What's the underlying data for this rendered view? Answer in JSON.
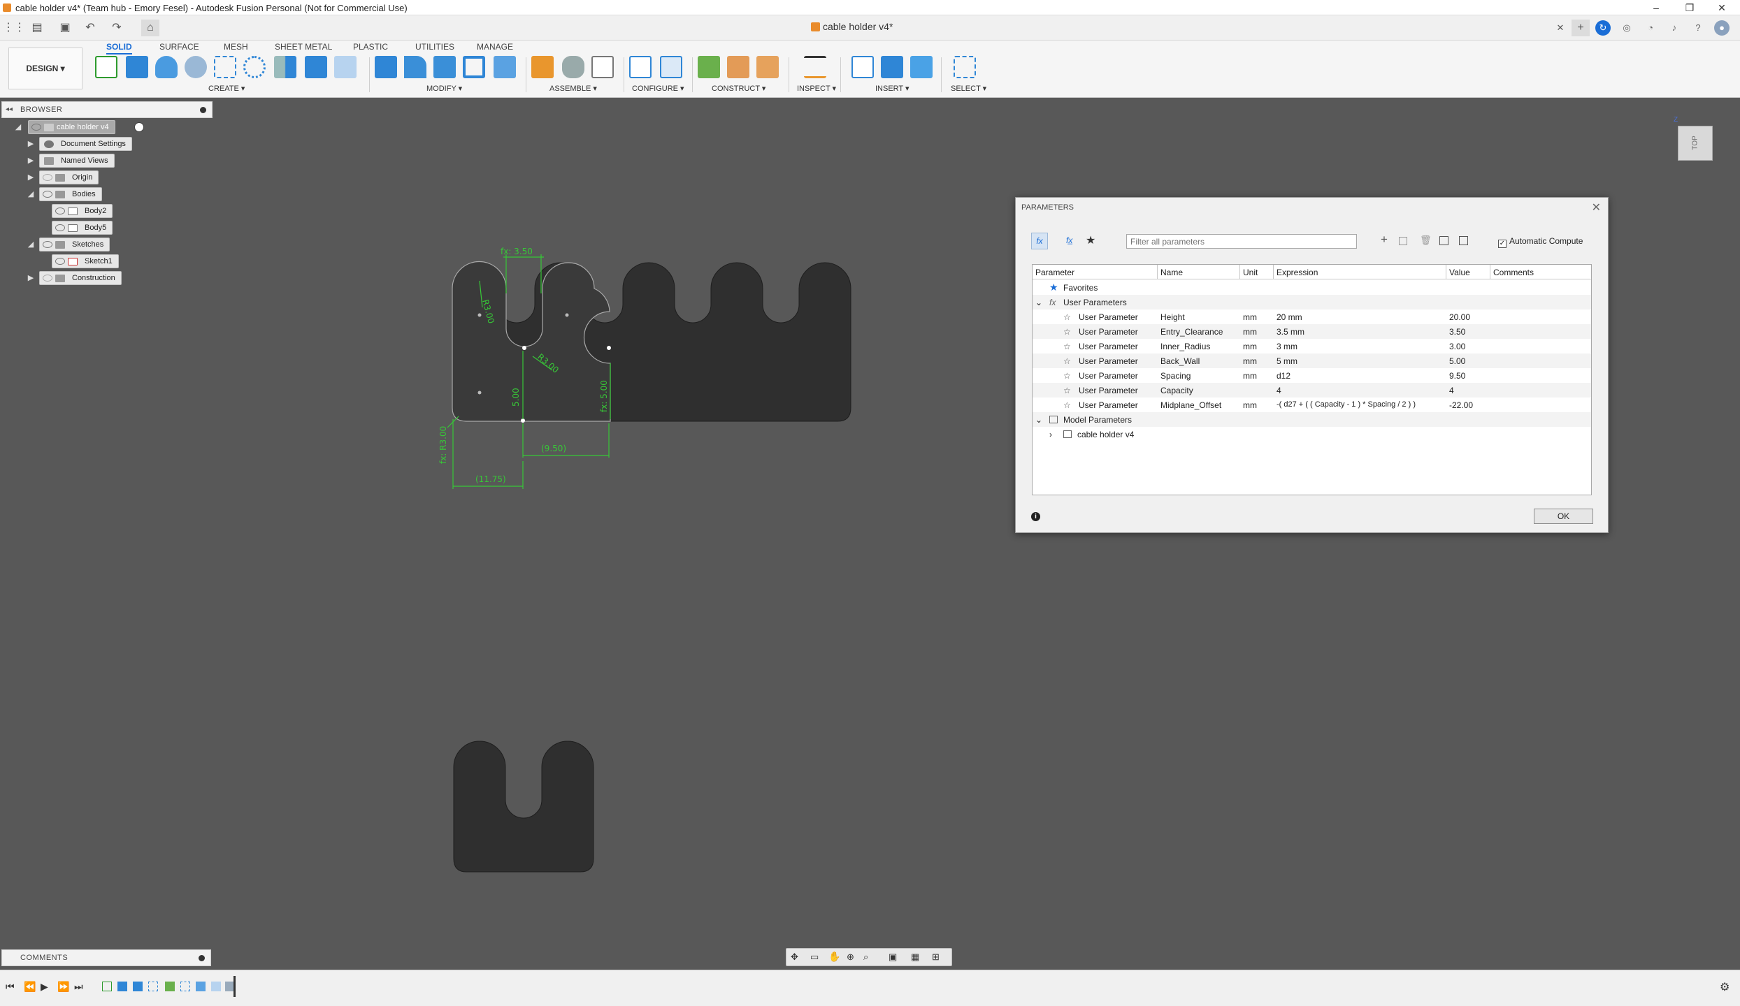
{
  "window": {
    "title": "cable holder v4* (Team hub - Emory Fesel) - Autodesk Fusion Personal (Not for Commercial Use)",
    "controls": [
      "–",
      "❐",
      "✕"
    ]
  },
  "tabbar": {
    "document_tab": "cable holder v4*",
    "close_glyph": "✕",
    "add_glyph": "+"
  },
  "toolbar": {
    "workspace": "DESIGN",
    "tabs": [
      "SOLID",
      "SURFACE",
      "MESH",
      "SHEET METAL",
      "PLASTIC",
      "UTILITIES",
      "MANAGE"
    ],
    "groups": [
      "CREATE",
      "MODIFY",
      "ASSEMBLE",
      "CONFIGURE",
      "CONSTRUCT",
      "INSPECT",
      "INSERT",
      "SELECT"
    ]
  },
  "browser": {
    "title": "BROWSER",
    "nodes": [
      {
        "label": "cable holder v4"
      },
      {
        "label": "Document Settings"
      },
      {
        "label": "Named Views"
      },
      {
        "label": "Origin"
      },
      {
        "label": "Bodies"
      },
      {
        "label": "Body2"
      },
      {
        "label": "Body5"
      },
      {
        "label": "Sketches"
      },
      {
        "label": "Sketch1"
      },
      {
        "label": "Construction"
      }
    ]
  },
  "sketch": {
    "dims": [
      "fx: 3.50",
      "R3.00",
      "R3.00",
      "5.00",
      "fx: 5.00",
      "fx: R3.00",
      "(9.50)",
      "(11.75)"
    ]
  },
  "viewcube": {
    "label": "TOP",
    "axis_label": "Z"
  },
  "comments": {
    "title": "COMMENTS"
  },
  "parameters": {
    "title": "PARAMETERS",
    "search_placeholder": "Filter all parameters",
    "automatic_compute": "Automatic Compute",
    "automatic_compute_checked": true,
    "columns": [
      "Parameter",
      "Name",
      "Unit",
      "Expression",
      "Value",
      "Comments"
    ],
    "favorites_label": "Favorites",
    "user_params_label": "User Parameters",
    "user_params": [
      {
        "param": "User Parameter",
        "name": "Height",
        "unit": "mm",
        "expr": "20 mm",
        "value": "20.00"
      },
      {
        "param": "User Parameter",
        "name": "Entry_Clearance",
        "unit": "mm",
        "expr": "3.5 mm",
        "value": "3.50"
      },
      {
        "param": "User Parameter",
        "name": "Inner_Radius",
        "unit": "mm",
        "expr": "3 mm",
        "value": "3.00"
      },
      {
        "param": "User Parameter",
        "name": "Back_Wall",
        "unit": "mm",
        "expr": "5 mm",
        "value": "5.00"
      },
      {
        "param": "User Parameter",
        "name": "Spacing",
        "unit": "mm",
        "expr": "d12",
        "value": "9.50"
      },
      {
        "param": "User Parameter",
        "name": "Capacity",
        "unit": "",
        "expr": "4",
        "value": "4"
      },
      {
        "param": "User Parameter",
        "name": "Midplane_Offset",
        "unit": "mm",
        "expr": "-( d27 + ( ( Capacity - 1 ) * Spacing / 2 ) )",
        "value": "-22.00"
      }
    ],
    "model_params_label": "Model Parameters",
    "model_child": "cable holder v4",
    "ok_label": "OK",
    "info_glyph": "i"
  },
  "colors": {
    "accent": "#1a6dd6",
    "viewport_bg": "#585858",
    "body_fill": "#2f2f2f",
    "sketch_green": "#37c837"
  }
}
